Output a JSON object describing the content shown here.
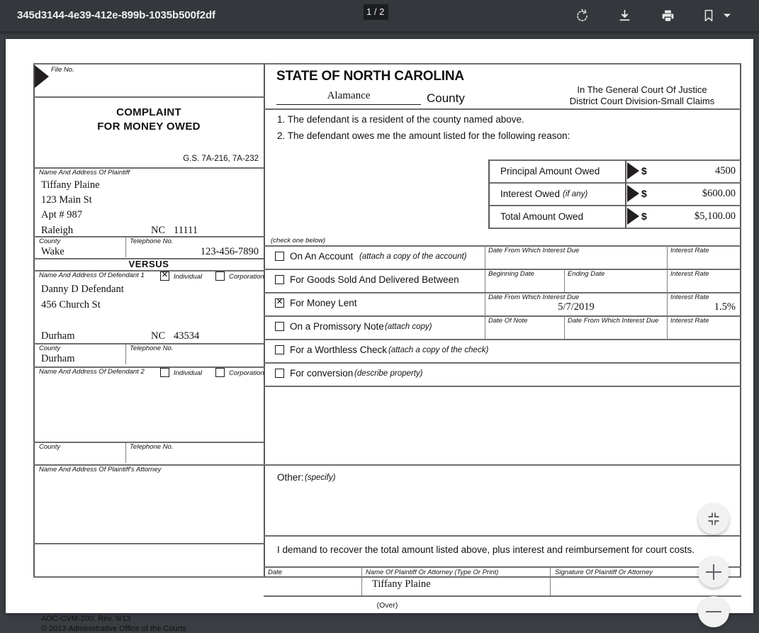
{
  "toolbar": {
    "document_title": "345d3144-4e39-412e-899b-1035b500f2df",
    "page_indicator": "1 / 2",
    "icons": {
      "rotate": "rotate-clockwise-icon",
      "download": "download-icon",
      "print": "print-icon",
      "bookmark": "bookmark-icon",
      "caret": "chevron-down-icon"
    }
  },
  "zoom_controls": {
    "fit": "fit-to-page",
    "zoom_in": "+",
    "zoom_out": "–"
  },
  "form": {
    "file_no_label": "File No.",
    "file_no_value": "",
    "title_line1": "COMPLAINT",
    "title_line2": "FOR MONEY OWED",
    "statute": "G.S. 7A-216, 7A-232",
    "state_heading": "STATE OF NORTH CAROLINA",
    "county_value": "Alamance",
    "county_word": "County",
    "court_line1": "In The General Court Of Justice",
    "court_line2": "District Court Division-Small Claims",
    "item1": "1.  The defendant is a resident of the county named above.",
    "item2": "2.  The defendant owes me the amount listed for the following reason:",
    "plaintiff": {
      "caption": "Name And Address Of Plaintiff",
      "name": "Tiffany Plaine",
      "street": "123 Main St",
      "unit": "Apt # 987",
      "city": "Raleigh",
      "state": "NC",
      "zip": "11111",
      "county_caption": "County",
      "county_value": "Wake",
      "phone_caption": "Telephone No.",
      "phone_value": "123-456-7890"
    },
    "versus": "VERSUS",
    "defendant1": {
      "caption": "Name And Address Of Defendant 1",
      "individual_label": "Individual",
      "individual_checked": true,
      "corporation_label": "Corporation",
      "corporation_checked": false,
      "name": "Danny D Defendant",
      "street": "456  Church St",
      "city": "Durham",
      "state": "NC",
      "zip": "43534",
      "county_caption": "County",
      "county_value": "Durham",
      "phone_caption": "Telephone No.",
      "phone_value": ""
    },
    "defendant2": {
      "caption": "Name And Address Of Defendant 2",
      "individual_label": "Individual",
      "individual_checked": false,
      "corporation_label": "Corporation",
      "corporation_checked": false,
      "county_caption": "County",
      "county_value": "",
      "phone_caption": "Telephone No.",
      "phone_value": ""
    },
    "attorney": {
      "caption": "Name And Address Of Plaintiff's Attorney",
      "value": ""
    },
    "amounts": {
      "rows": [
        {
          "label": "Principal Amount Owed",
          "label_note": "",
          "currency": "$",
          "value": "4500"
        },
        {
          "label": "Interest Owed ",
          "label_note": "(if any)",
          "currency": "$",
          "value": "$600.00"
        },
        {
          "label": "Total Amount Owed",
          "label_note": "",
          "currency": "$",
          "value": "$5,100.00"
        }
      ]
    },
    "check_one_below": "(check one below)",
    "reasons": [
      {
        "checked": false,
        "label": "On An Account ",
        "note": "(attach a copy of the account)"
      },
      {
        "checked": false,
        "label": "For Goods Sold And Delivered Between",
        "note": ""
      },
      {
        "checked": true,
        "label": "For Money Lent",
        "note": ""
      },
      {
        "checked": false,
        "label": "On a Promissory Note ",
        "note": "(attach copy)"
      },
      {
        "checked": false,
        "label": "For a Worthless Check ",
        "note": "(attach a copy of the check)"
      },
      {
        "checked": false,
        "label": "For conversion ",
        "note": "(describe property)"
      }
    ],
    "reason_fields": {
      "r1_date_caption": "Date From Which Interest Due",
      "r1_date_value": "",
      "r1_rate_caption": "Interest Rate",
      "r1_rate_value": "",
      "r2_begin_caption": "Beginning Date",
      "r2_begin_value": "",
      "r2_end_caption": "Ending Date",
      "r2_end_value": "",
      "r2_rate_caption": "Interest Rate",
      "r2_rate_value": "",
      "r3_date_caption": "Date From Which Interest Due",
      "r3_date_value": "5/7/2019",
      "r3_rate_caption": "Interest Rate",
      "r3_rate_value": "1.5%",
      "r4_note_caption": "Date Of Note",
      "r4_note_value": "",
      "r4_date_caption": "Date From Which Interest Due",
      "r4_date_value": "",
      "r4_rate_caption": "Interest Rate",
      "r4_rate_value": ""
    },
    "other_label": "Other:",
    "other_note": "(specify)",
    "other_value": "",
    "demand": "I demand to recover the total amount listed above, plus interest and reimbursement for court costs.",
    "signature_row": {
      "date_caption": "Date",
      "date_value": "",
      "name_caption": "Name Of Plaintiff Or Attorney (Type Or Print)",
      "name_value": "Tiffany Plaine",
      "signature_caption": "Signature Of Plaintiff Or Attorney",
      "signature_value": ""
    },
    "over": "(Over)",
    "footer_line1": "AOC-CVM-200, Rev. 9/13",
    "footer_line2": "© 2013 Administrative Office of the Courts"
  },
  "colors": {
    "toolbar_bg": "#34373b",
    "viewer_bg": "#3a3d42",
    "page_bg": "#ffffff",
    "rule": "#808080",
    "ink": "#111111"
  }
}
